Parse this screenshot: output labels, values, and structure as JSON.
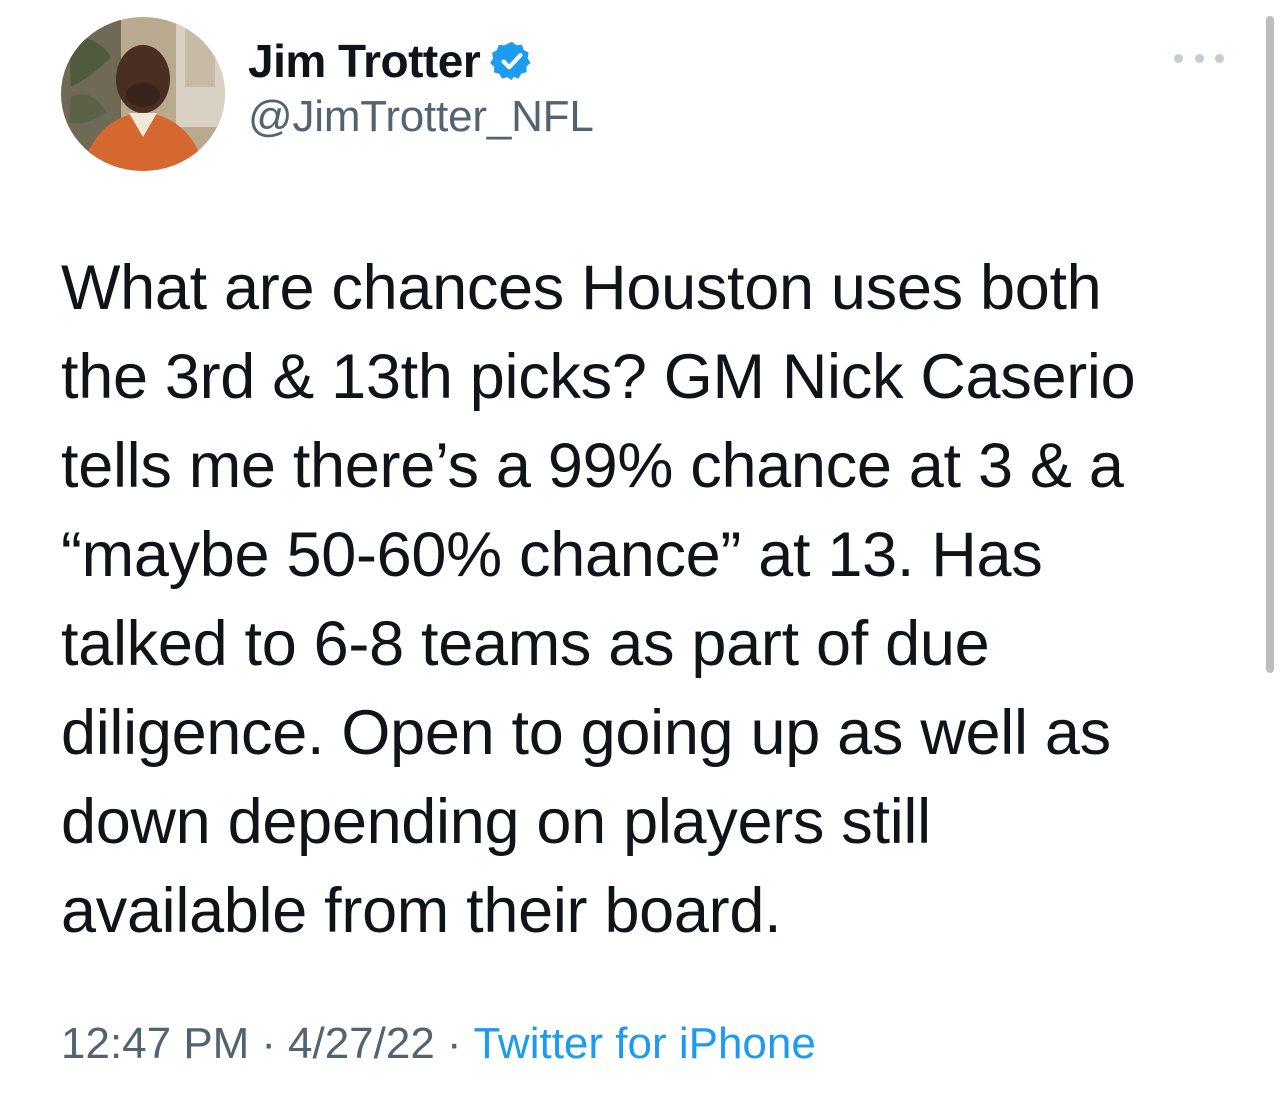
{
  "author": {
    "display_name": "Jim Trotter",
    "handle": "@JimTrotter_NFL",
    "verified": true,
    "verified_icon": "verified-badge-icon",
    "verified_color": "#1d9bf0"
  },
  "tweet": {
    "text": "What are chances Houston uses both\nthe 3rd & 13th picks? GM Nick Caserio\ntells me there’s a 99% chance at 3 & a\n“maybe 50-60% chance” at 13. Has\ntalked to 6-8 teams as part of due\ndiligence. Open to going up as well as\ndown depending on players still\navailable from their board."
  },
  "meta": {
    "time": "12:47 PM",
    "separator": "·",
    "date": "4/27/22",
    "source": "Twitter for iPhone"
  },
  "icons": {
    "more": "more-horizontal-icon"
  },
  "colors": {
    "text": "#0f1419",
    "secondary": "#536471",
    "link": "#1d9bf0"
  }
}
